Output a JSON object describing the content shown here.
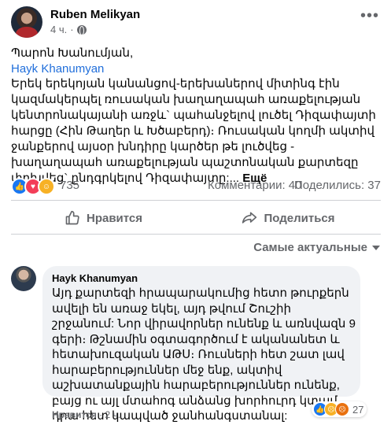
{
  "post": {
    "author": "Ruben Melikyan",
    "time": "4 ч.",
    "dot": "·",
    "greeting": "Պարոն Խանումյան,",
    "mention": "Hayk Khanumyan",
    "text": "Երեկ երեկոյան կանանցով-երեխաներով միտինգ էին կազմակերպել ռուսական խաղաղապահ առաքելության կենտրոնակայանի առջև` պահանջելով լուծել Դիզափայտի հարցը (Հին Թաղեր և Խծաբերդ)։ Ռուսական կողմի ակտիվ ջանքերով այսօր խնդիրը կարծեր թե լուծվեց - խաղաղապահ առաքելության պաշտոնական քարտեզը փոխվեց` ընդգրկելով Դիզափայտը:...",
    "see_more": "Ещё",
    "reaction_count": "735",
    "comments": "Комментарии: 40",
    "shares": "Поделились: 37"
  },
  "actions": {
    "like": "Нравится",
    "share": "Поделиться"
  },
  "sort_label": "Самые актуальные",
  "comment": {
    "author": "Hayk Khanumyan",
    "text": "Այդ քարտեզի հրապարակումից հետո թուրքերն ավելի են առաջ եկել, այդ թվում Շուշիի շրջանում: Նոր վիրավորներ ունենք և առնվազն 9 գերի։ Թշնամին օգտագործում է ականանետ և հետախուզական ԱԹՍ։ Ռուսների հետ շատ լավ հարաբերություններ մեջ ենք, ակտիվ աշխատանքային հարաբերություններ ունենք, բայց ու այլ մտահոգ անձանց խորհուրդ կտամ դրա հետ կապված ջանհանգստանալ:",
    "reaction_count": "27",
    "like": "Нравится",
    "time": "2 ч."
  },
  "colors": {
    "link": "#216fdb",
    "meta": "#65676b",
    "like_blue": "#1877f2"
  }
}
